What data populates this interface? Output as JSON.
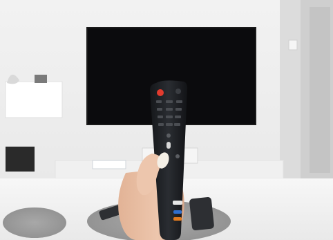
{
  "scene": {
    "subject": "hand-holding-tv-remote",
    "colors": {
      "wall": "#eeeeee",
      "tv_screen": "#0b0b0d",
      "remote_body": "#1e2024",
      "remote_power": "#e23b2e",
      "skin": "#e9bfa6",
      "nail": "#f4efe6",
      "table_top": "#f3f3f3",
      "floor": "#c9a27a",
      "rug": "#9c9c9c"
    }
  }
}
